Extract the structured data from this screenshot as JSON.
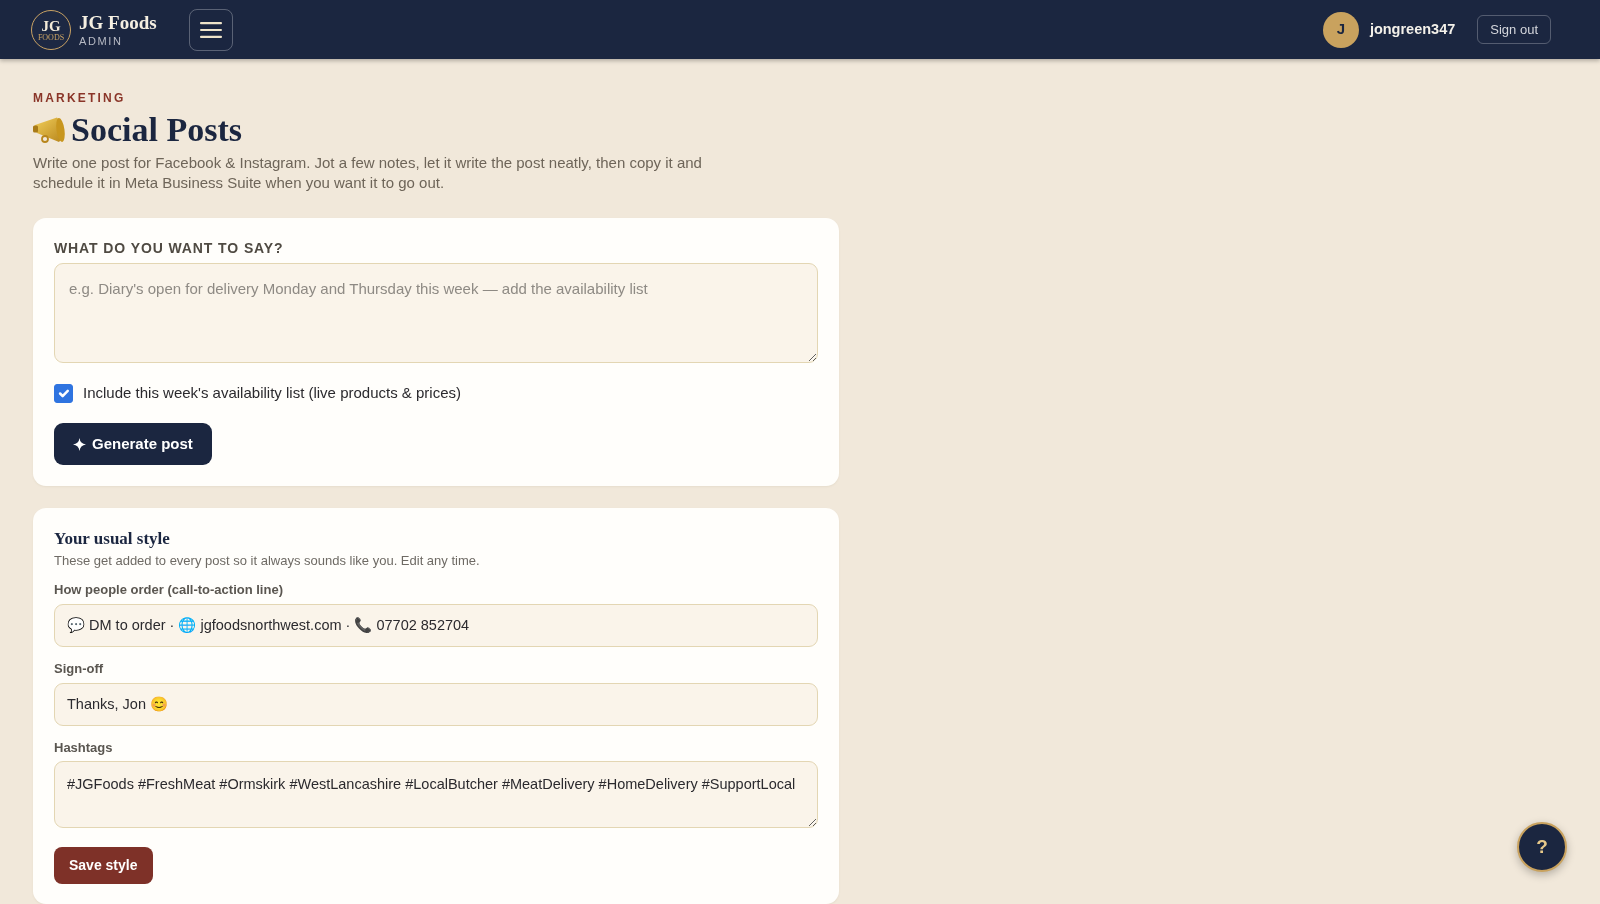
{
  "header": {
    "logo": {
      "monogram": "JG",
      "subtext": "FOODS"
    },
    "brand_name": "JG Foods",
    "brand_subtitle": "ADMIN",
    "user": {
      "avatar_initial": "J",
      "username": "jongreen347"
    },
    "sign_out": "Sign out"
  },
  "page": {
    "eyebrow": "MARKETING",
    "title": "Social Posts",
    "description": "Write one post for Facebook & Instagram. Jot a few notes, let it write the post neatly, then copy it and schedule it in Meta Business Suite when you want it to go out."
  },
  "compose_card": {
    "label": "WHAT DO YOU WANT TO SAY?",
    "message": {
      "placeholder": "e.g. Diary's open for delivery Monday and Thursday this week — add the availability list"
    },
    "include_availability": {
      "label": "Include this week's availability list (live products & prices)",
      "checked": true
    },
    "generate_button": "Generate post"
  },
  "style_card": {
    "title": "Your usual style",
    "subtitle": "These get added to every post so it always sounds like you. Edit any time.",
    "fields": [
      {
        "kind": "input",
        "label": "How people order (call-to-action line)",
        "value": "💬 DM to order · 🌐 jgfoodsnorthwest.com · 📞 07702 852704"
      },
      {
        "kind": "input",
        "label": "Sign-off",
        "value": "Thanks, Jon 😊"
      },
      {
        "kind": "textarea",
        "label": "Hashtags",
        "value": "#JGFoods #FreshMeat #Ormskirk #WestLancashire #LocalButcher #MeatDelivery #HomeDelivery #SupportLocal"
      }
    ],
    "save_button": "Save style"
  },
  "help_button": "?"
}
